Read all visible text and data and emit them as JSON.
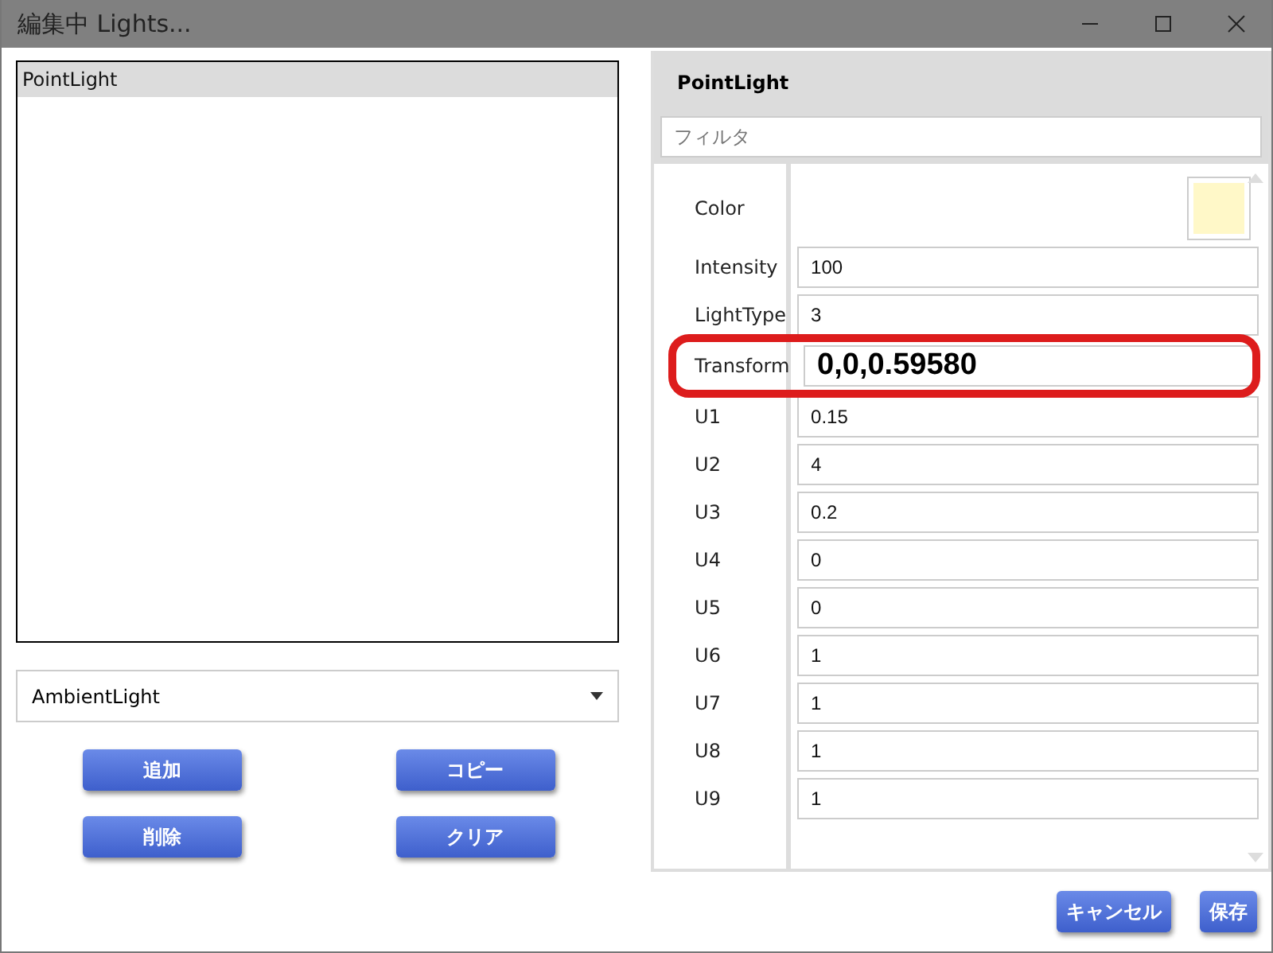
{
  "window": {
    "title": "編集中 Lights..."
  },
  "lights_list": {
    "items": [
      {
        "label": "PointLight",
        "selected": true
      }
    ]
  },
  "light_type_dropdown": {
    "value": "AmbientLight"
  },
  "list_buttons": [
    "追加",
    "コピー",
    "削除",
    "クリア"
  ],
  "properties": {
    "title": "PointLight",
    "filter": {
      "placeholder": "フィルタ"
    },
    "rows": [
      {
        "kind": "color",
        "label": "Color",
        "color": "#fff8c8",
        "highlighted": false
      },
      {
        "kind": "text",
        "label": "Intensity",
        "value": "100",
        "highlighted": false
      },
      {
        "kind": "text",
        "label": "LightType",
        "value": "3",
        "highlighted": false
      },
      {
        "kind": "text",
        "label": "Transform",
        "value": "0,0,0.59580",
        "highlighted": true
      },
      {
        "kind": "text",
        "label": "U1",
        "value": "0.15",
        "highlighted": false
      },
      {
        "kind": "text",
        "label": "U2",
        "value": "4",
        "highlighted": false
      },
      {
        "kind": "text",
        "label": "U3",
        "value": "0.2",
        "highlighted": false
      },
      {
        "kind": "text",
        "label": "U4",
        "value": "0",
        "highlighted": false
      },
      {
        "kind": "text",
        "label": "U5",
        "value": "0",
        "highlighted": false
      },
      {
        "kind": "text",
        "label": "U6",
        "value": "1",
        "highlighted": false
      },
      {
        "kind": "text",
        "label": "U7",
        "value": "1",
        "highlighted": false
      },
      {
        "kind": "text",
        "label": "U8",
        "value": "1",
        "highlighted": false
      },
      {
        "kind": "text",
        "label": "U9",
        "value": "1",
        "highlighted": false
      }
    ]
  },
  "footer_buttons": [
    "キャンセル",
    "保存"
  ]
}
